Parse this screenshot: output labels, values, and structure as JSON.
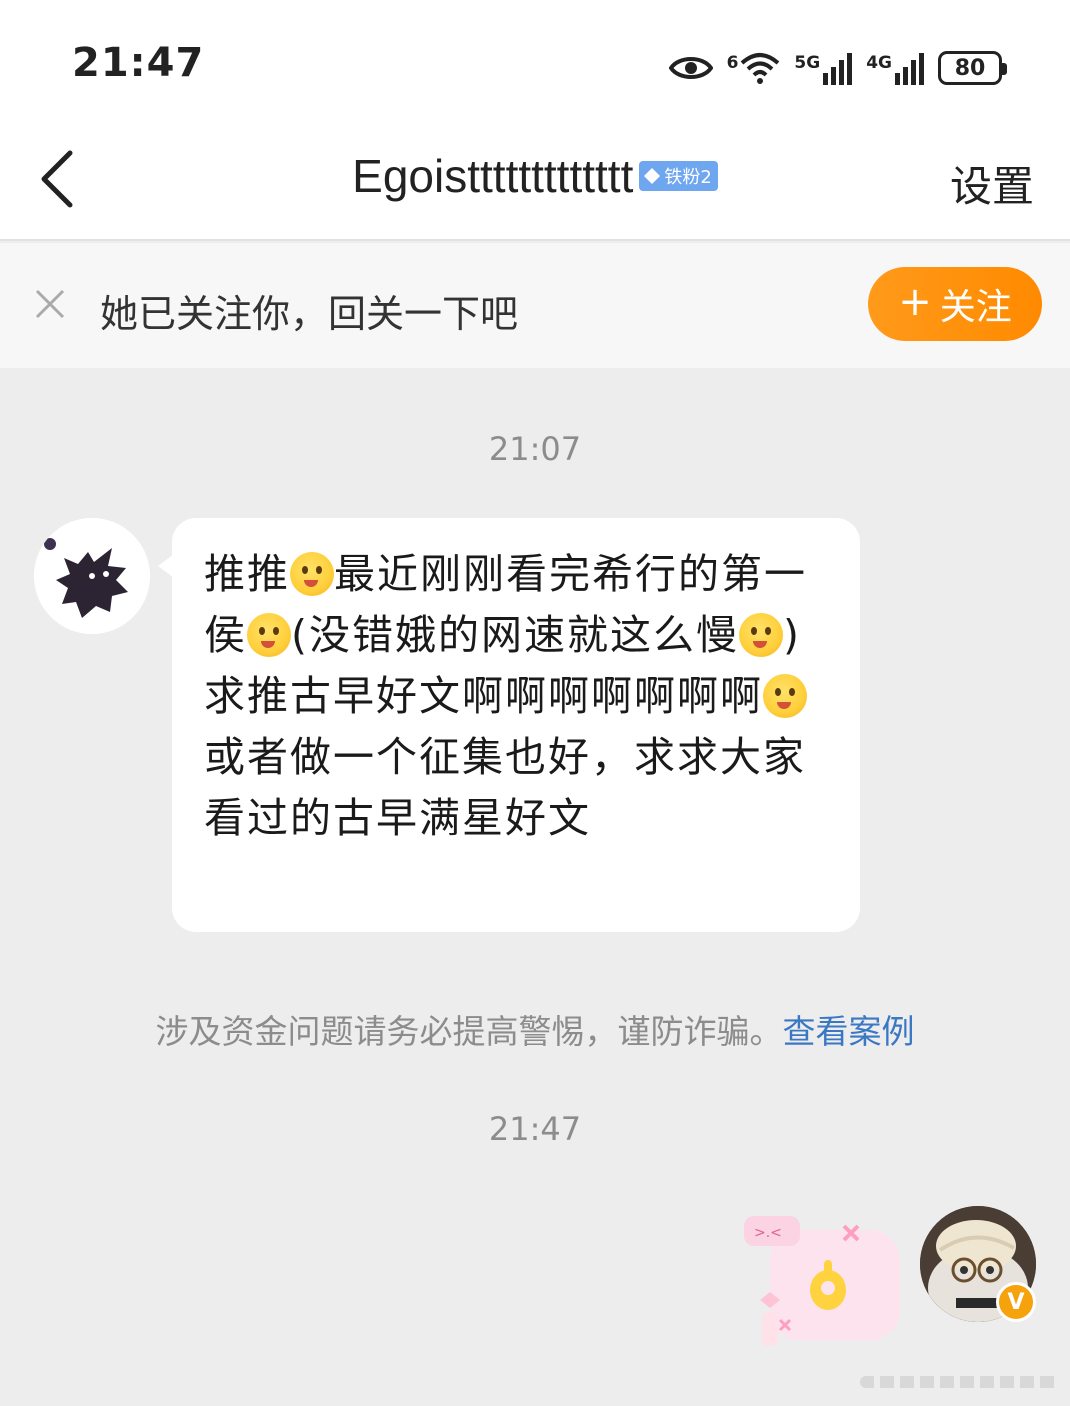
{
  "status_bar": {
    "time": "21:47",
    "wifi_label": "6",
    "net1_label": "5G",
    "net2_label": "4G",
    "battery": "80"
  },
  "header": {
    "title": "Egoisttttttttttttt",
    "fan_badge": "铁粉2",
    "settings_label": "设置"
  },
  "follow_bar": {
    "text": "她已关注你，回关一下吧",
    "button_plus": "+",
    "button_label": "关注"
  },
  "chat": {
    "timestamp_1": "21:07",
    "message": {
      "p1": "推推",
      "p2": "最近刚刚看完希行的第一侯",
      "p3": "(没错娥的网速就这么慢",
      "p4": ") 求推古早好文啊啊啊啊啊啊啊",
      "p5": "或者做一个征集也好，求求大家看过的古早满星好文"
    },
    "warning_text": "涉及资金问题请务必提高警惕，谨防诈骗。",
    "warning_link": "查看案例",
    "timestamp_2": "21:47",
    "avatar_badge": "V"
  },
  "colors": {
    "follow_button": "#ff9100",
    "link": "#3b78c4",
    "fan_badge": "#6fa6f0",
    "vip_badge": "#f5a20d"
  }
}
